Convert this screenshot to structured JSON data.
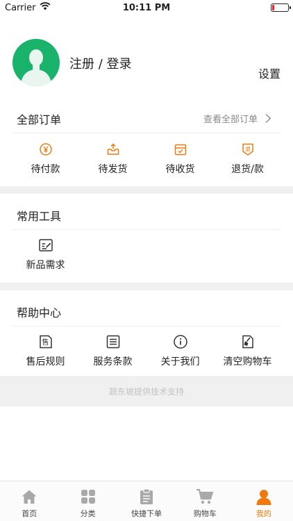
{
  "status_bar": {
    "carrier": "Carrier",
    "time": "10:11 PM"
  },
  "profile": {
    "login_label": "注册 / 登录",
    "settings_label": "设置"
  },
  "orders": {
    "title": "全部订单",
    "see_all": "查看全部订单",
    "items": [
      {
        "label": "待付款",
        "icon": "pending-payment-icon"
      },
      {
        "label": "待发货",
        "icon": "pending-shipment-icon"
      },
      {
        "label": "待收货",
        "icon": "pending-receipt-icon"
      },
      {
        "label": "退货/款",
        "icon": "refund-icon"
      }
    ]
  },
  "tools": {
    "title": "常用工具",
    "items": [
      {
        "label": "新品需求",
        "icon": "new-product-request-icon"
      }
    ]
  },
  "help": {
    "title": "帮助中心",
    "items": [
      {
        "label": "售后规则",
        "icon": "after-sales-icon"
      },
      {
        "label": "服务条款",
        "icon": "terms-icon"
      },
      {
        "label": "关于我们",
        "icon": "info-icon"
      },
      {
        "label": "清空购物车",
        "icon": "clear-cart-icon"
      }
    ],
    "refund_glyph": "退",
    "after_sales_glyph": "售"
  },
  "footer": {
    "text": "蔬东坡提供技术支持"
  },
  "tabbar": {
    "items": [
      {
        "label": "首页",
        "icon": "home-icon"
      },
      {
        "label": "分类",
        "icon": "category-icon"
      },
      {
        "label": "快捷下单",
        "icon": "clipboard-icon"
      },
      {
        "label": "购物车",
        "icon": "cart-icon"
      },
      {
        "label": "我的",
        "icon": "person-icon",
        "active": true
      }
    ]
  },
  "colors": {
    "accent": "#f07a0f",
    "avatar_bg": "#19b36b",
    "band": "#f0f0f0"
  }
}
